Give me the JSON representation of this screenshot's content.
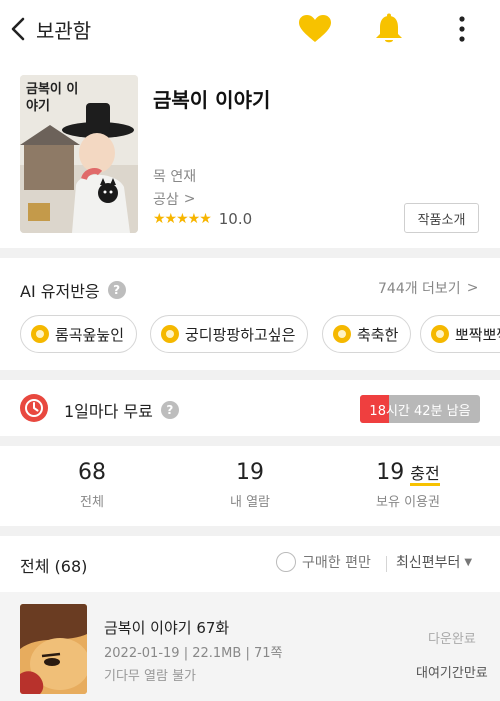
{
  "topbar": {
    "back_label": "보관함",
    "accent": "#f7c200"
  },
  "webtoon": {
    "cover_title": "금복이 이야기",
    "title": "금복이 이야기",
    "schedule": "목 연재",
    "author": "공삼",
    "rating_stars": "★★★★★",
    "rating_value": "10.0",
    "intro_button": "작품소개"
  },
  "ai_section": {
    "title": "AI 유저반응",
    "more_label": "744개 더보기",
    "chips": [
      {
        "label": "롬곡옾눞인"
      },
      {
        "label": "궁디팡팡하고싶은"
      },
      {
        "label": "축축한"
      },
      {
        "label": "뽀짝뽀짝"
      }
    ]
  },
  "free_wait": {
    "label": "1일마다 무료",
    "timer_text": "18시간 42분 남음",
    "timer_remaining_fraction": 0.24,
    "timer_color": "#ef3f3f"
  },
  "stats": [
    {
      "value": "68",
      "label": "전체"
    },
    {
      "value": "19",
      "label": "내 열람"
    },
    {
      "value": "19",
      "label": "보유 이용권",
      "action": "충전"
    }
  ],
  "list": {
    "title": "전체 (68)",
    "filter_label": "구매한 편만",
    "sort_label": "최신편부터"
  },
  "episodes": [
    {
      "title": "금복이 이야기 67화",
      "date": "2022-01-19",
      "size": "22.1MB",
      "pages": "71쪽",
      "note": "기다무 열람 불가",
      "status": "다운완료",
      "rental": "대여기간만료"
    }
  ]
}
